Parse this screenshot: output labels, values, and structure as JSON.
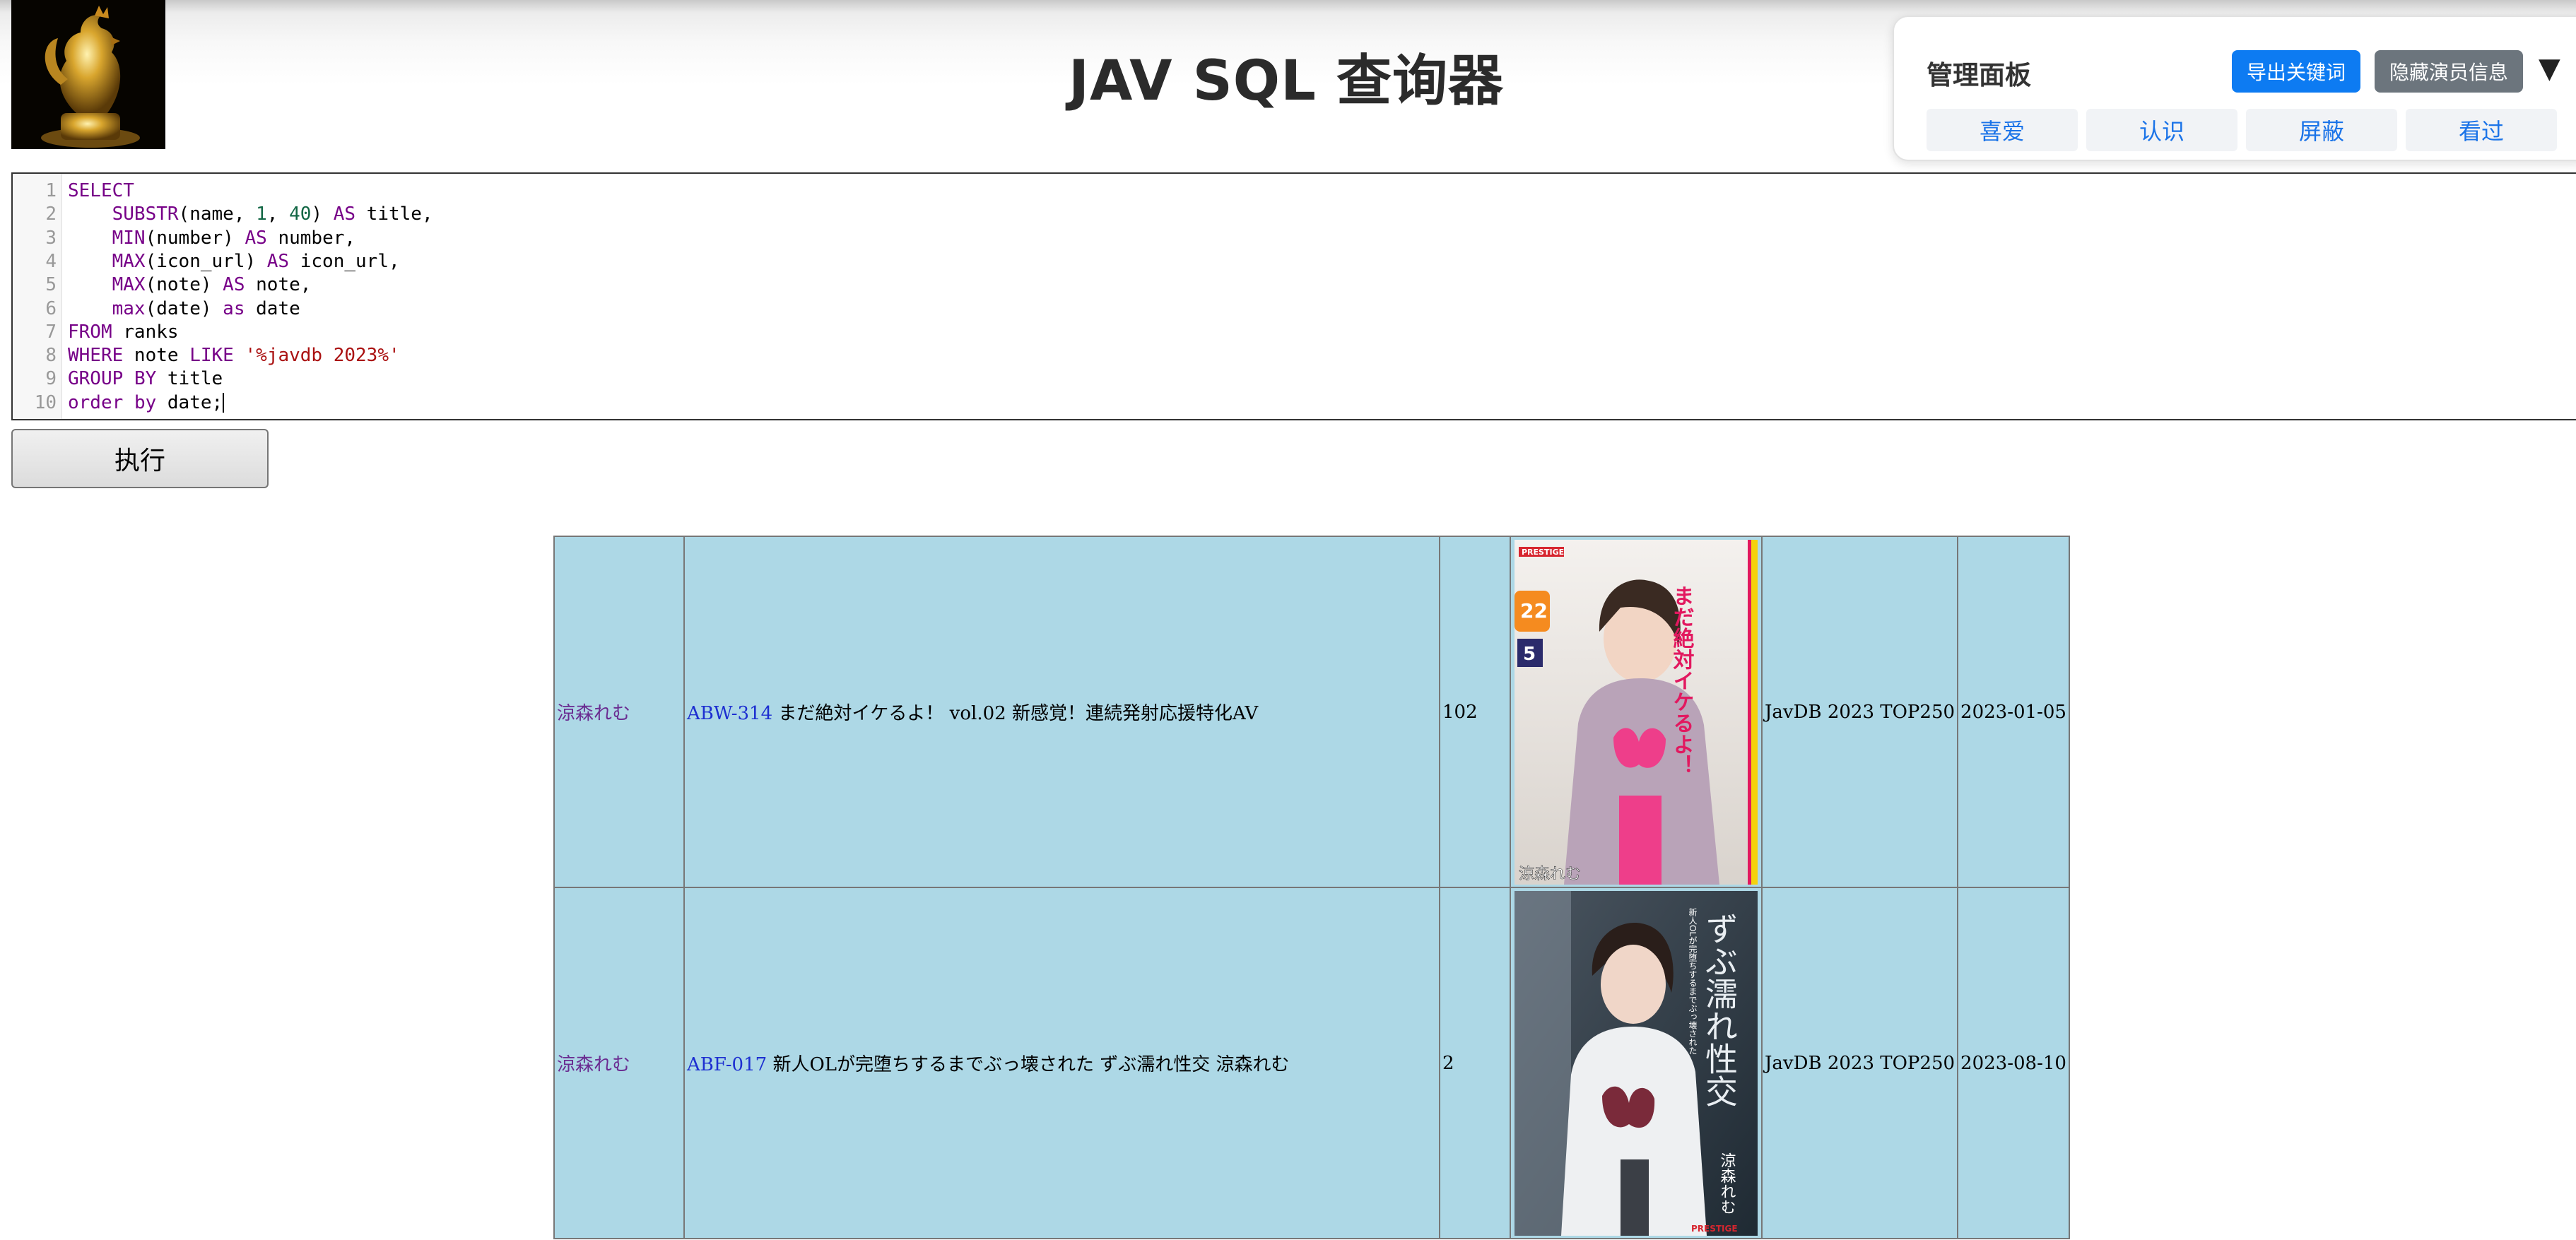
{
  "header": {
    "title": "JAV SQL 查询器",
    "logo_icon": "golden-rooster-trophy"
  },
  "admin_panel": {
    "title": "管理面板",
    "export_label": "导出关键词",
    "hide_label": "隐藏演员信息",
    "toggle_glyph": "▼",
    "tabs": [
      "喜爱",
      "认识",
      "屏蔽",
      "看过"
    ]
  },
  "editor": {
    "line_numbers": [
      "1",
      "2",
      "3",
      "4",
      "5",
      "6",
      "7",
      "8",
      "9",
      "10"
    ],
    "query": "SELECT\n    SUBSTR(name, 1, 40) AS title,\n    MIN(number) AS number,\n    MAX(icon_url) AS icon_url,\n    MAX(note) AS note,\n    max(date) as date\nFROM ranks\nWHERE note LIKE '%javdb 2023%'\nGROUP BY title\norder by date;"
  },
  "run_button": {
    "label": "执行"
  },
  "results": {
    "rows": [
      {
        "actor": "涼森れむ",
        "code": "ABW-314",
        "title": "まだ絶対イケるよ！ vol.02 新感覚！連続発射応援特化AV",
        "number": "102",
        "note": "JavDB 2023 TOP250",
        "date": "2023-01-05",
        "cover_text": {
          "brand": "PRESTIGE",
          "headline": "まだ絶対イケるよ！",
          "age": "22",
          "count": "5",
          "name": "涼森れむ"
        }
      },
      {
        "actor": "涼森れむ",
        "code": "ABF-017",
        "title": "新人OLが完堕ちするまでぶっ壊された ずぶ濡れ性交 涼森れむ",
        "number": "2",
        "note": "JavDB 2023 TOP250",
        "date": "2023-08-10",
        "cover_text": {
          "brand": "PRESTIGE",
          "headline": "ずぶ濡れ性交",
          "sub": "新人OLが完堕ちするまでぶっ壊された",
          "name": "涼森れむ"
        }
      }
    ]
  },
  "colors": {
    "table_bg": "#add8e6",
    "export_button": "#0d7bf2",
    "hide_button": "#6c757d",
    "tab_text": "#1a73e8",
    "keyword": "#770088",
    "number": "#116644",
    "string": "#aa1111"
  }
}
